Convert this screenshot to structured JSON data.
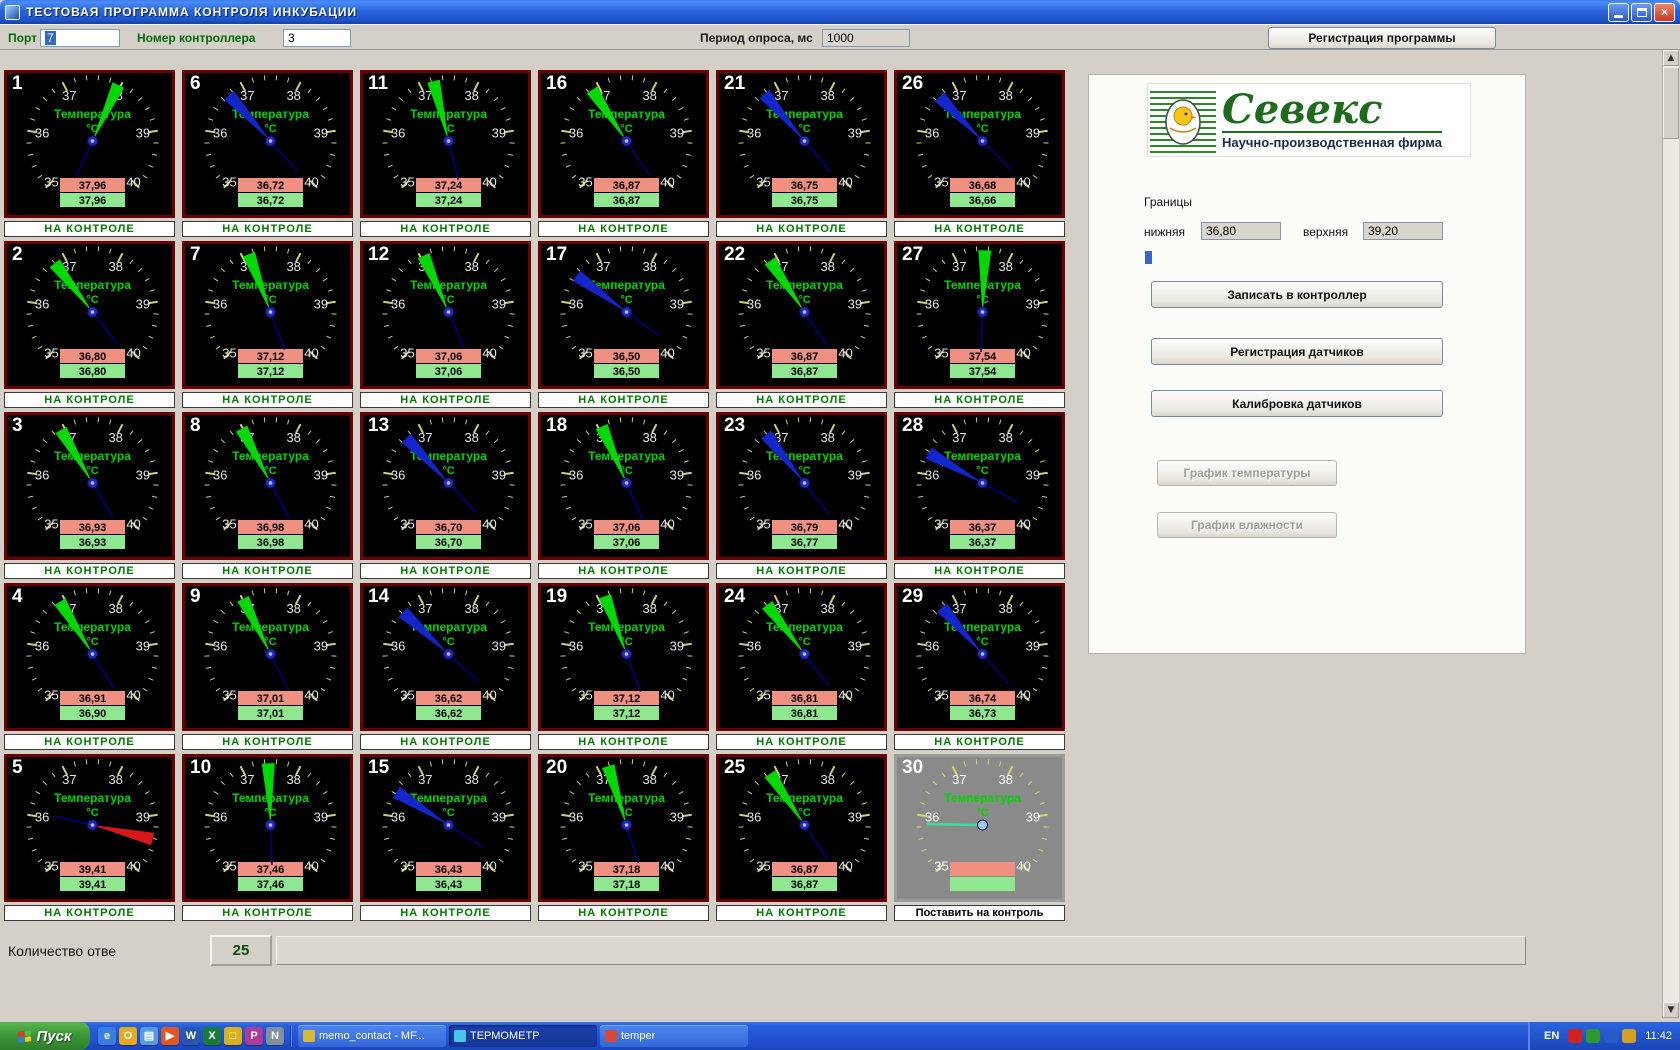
{
  "window": {
    "title": "ТЕСТОВАЯ ПРОГРАММА КОНТРОЛЯ ИНКУБАЦИИ"
  },
  "toolbar": {
    "port_label": "Порт",
    "port_value": "7",
    "controller_label": "Номер контроллера",
    "controller_value": "3",
    "poll_label": "Период опроса, мс",
    "poll_value": "1000",
    "register_button": "Регистрация программы"
  },
  "gauges": {
    "title": "Температура",
    "units": "°C",
    "scale_ticks": [
      35,
      36,
      37,
      38,
      39,
      40
    ],
    "status_label": "НА КОНТРОЛЕ",
    "control_button": "Поставить на контроль",
    "needle_colors": {
      "green": "#00d800",
      "blue": "#1226cc",
      "red": "#d81818",
      "off": "#38e0a0"
    },
    "off_needle_value": 35.85,
    "items": [
      {
        "num": 1,
        "value": "37,96",
        "value2": "37,96",
        "needle": "green"
      },
      {
        "num": 6,
        "value": "36,72",
        "value2": "36,72",
        "needle": "blue"
      },
      {
        "num": 11,
        "value": "37,24",
        "value2": "37,24",
        "needle": "green"
      },
      {
        "num": 16,
        "value": "36,87",
        "value2": "36,87",
        "needle": "green"
      },
      {
        "num": 21,
        "value": "36,75",
        "value2": "36,75",
        "needle": "blue"
      },
      {
        "num": 26,
        "value": "36,68",
        "value2": "36,66",
        "needle": "blue"
      },
      {
        "num": 2,
        "value": "36,80",
        "value2": "36,80",
        "needle": "green"
      },
      {
        "num": 7,
        "value": "37,12",
        "value2": "37,12",
        "needle": "green"
      },
      {
        "num": 12,
        "value": "37,06",
        "value2": "37,06",
        "needle": "green"
      },
      {
        "num": 17,
        "value": "36,50",
        "value2": "36,50",
        "needle": "blue"
      },
      {
        "num": 22,
        "value": "36,87",
        "value2": "36,87",
        "needle": "green"
      },
      {
        "num": 27,
        "value": "37,54",
        "value2": "37,54",
        "needle": "green"
      },
      {
        "num": 3,
        "value": "36,93",
        "value2": "36,93",
        "needle": "green"
      },
      {
        "num": 8,
        "value": "36,98",
        "value2": "36,98",
        "needle": "green"
      },
      {
        "num": 13,
        "value": "36,70",
        "value2": "36,70",
        "needle": "blue"
      },
      {
        "num": 18,
        "value": "37,06",
        "value2": "37,06",
        "needle": "green"
      },
      {
        "num": 23,
        "value": "36,79",
        "value2": "36,77",
        "needle": "blue"
      },
      {
        "num": 28,
        "value": "36,37",
        "value2": "36,37",
        "needle": "blue"
      },
      {
        "num": 4,
        "value": "36,91",
        "value2": "36,90",
        "needle": "green"
      },
      {
        "num": 9,
        "value": "37,01",
        "value2": "37,01",
        "needle": "green"
      },
      {
        "num": 14,
        "value": "36,62",
        "value2": "36,62",
        "needle": "blue"
      },
      {
        "num": 19,
        "value": "37,12",
        "value2": "37,12",
        "needle": "green"
      },
      {
        "num": 24,
        "value": "36,81",
        "value2": "36,81",
        "needle": "green"
      },
      {
        "num": 29,
        "value": "36,74",
        "value2": "36,73",
        "needle": "blue"
      },
      {
        "num": 5,
        "value": "39,41",
        "value2": "39,41",
        "needle": "red"
      },
      {
        "num": 10,
        "value": "37,46",
        "value2": "37,46",
        "needle": "green"
      },
      {
        "num": 15,
        "value": "36,43",
        "value2": "36,43",
        "needle": "blue"
      },
      {
        "num": 20,
        "value": "37,18",
        "value2": "37,18",
        "needle": "green"
      },
      {
        "num": 25,
        "value": "36,87",
        "value2": "36,87",
        "needle": "green"
      },
      {
        "num": 30,
        "value": "",
        "value2": "",
        "needle": "off"
      }
    ]
  },
  "side_panel": {
    "logo_title": "Севекс",
    "logo_subtitle": "Научно-производственная фирма",
    "bounds_label": "Границы",
    "lower_label": "нижняя",
    "lower_value": "36,80",
    "upper_label": "верхняя",
    "upper_value": "39,20",
    "buttons": [
      "Записать в контроллер",
      "Регистрация датчиков",
      "Калибровка датчиков"
    ],
    "disabled_buttons": [
      "График температуры",
      "График влажности"
    ]
  },
  "status_bar": {
    "count_label": "Количество отве",
    "count_value": "25"
  },
  "taskbar": {
    "start_label": "Пуск",
    "quicklaunch": [
      {
        "name": "internet-explorer-icon",
        "bg": "#3a7de0",
        "glyph": "e"
      },
      {
        "name": "outlook-icon",
        "bg": "#e8a820",
        "glyph": "O"
      },
      {
        "name": "show-desktop-icon",
        "bg": "#5a9ae0",
        "glyph": "▤"
      },
      {
        "name": "media-player-icon",
        "bg": "#e05820",
        "glyph": "▶"
      },
      {
        "name": "word-icon",
        "bg": "#2a56b0",
        "glyph": "W"
      },
      {
        "name": "excel-icon",
        "bg": "#1a7a3a",
        "glyph": "X"
      },
      {
        "name": "explorer-icon",
        "bg": "#d8b020",
        "glyph": "□"
      },
      {
        "name": "paint-icon",
        "bg": "#b03a9a",
        "glyph": "P"
      },
      {
        "name": "notepad-icon",
        "bg": "#8090a0",
        "glyph": "N"
      }
    ],
    "tasks": [
      {
        "label": "memo_contact - MF...",
        "active": false,
        "icon_bg": "#d8b838"
      },
      {
        "label": "ТЕРМОМЕТР",
        "active": true,
        "icon_bg": "#48c8e8"
      },
      {
        "label": "temper",
        "active": false,
        "icon_bg": "#d84838"
      }
    ],
    "tray_icons": [
      {
        "name": "antivirus-tray-icon",
        "bg": "#d02020"
      },
      {
        "name": "volume-tray-icon",
        "bg": "#2a9a2a"
      },
      {
        "name": "network-tray-icon",
        "bg": "#2a5ac8"
      },
      {
        "name": "scheduler-tray-icon",
        "bg": "#d8a020"
      }
    ],
    "tray_lang": "EN",
    "tray_time": "11:42"
  }
}
